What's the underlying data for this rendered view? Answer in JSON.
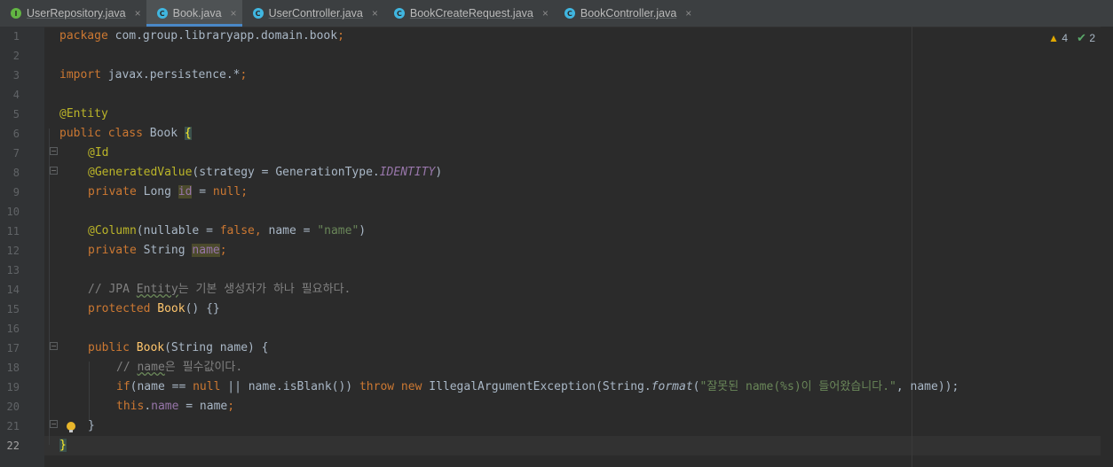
{
  "tabs": [
    {
      "label": "UserRepository.java",
      "icon": "interface-file-icon",
      "badge": "I",
      "active": false
    },
    {
      "label": "Book.java",
      "icon": "class-file-icon",
      "badge": "C",
      "active": true
    },
    {
      "label": "UserController.java",
      "icon": "class-file-icon",
      "badge": "C",
      "active": false
    },
    {
      "label": "BookCreateRequest.java",
      "icon": "class-file-icon",
      "badge": "C",
      "active": false
    },
    {
      "label": "BookController.java",
      "icon": "class-file-icon",
      "badge": "C",
      "active": false
    }
  ],
  "close_glyph": "×",
  "inspections": {
    "warnings": "4",
    "checks": "2",
    "warning_icon": "warning-triangle-icon",
    "check_icon": "double-check-icon"
  },
  "line_numbers": [
    "1",
    "2",
    "3",
    "4",
    "5",
    "6",
    "7",
    "8",
    "9",
    "10",
    "11",
    "12",
    "13",
    "14",
    "15",
    "16",
    "17",
    "18",
    "19",
    "20",
    "21",
    "22"
  ],
  "current_line": 22,
  "code": {
    "l1": {
      "kw": "package",
      "rest": " com.group.libraryapp.domain.book",
      "semi": ";"
    },
    "l3": {
      "kw": "import",
      "rest": " javax.persistence.*",
      "semi": ";"
    },
    "l5": {
      "an": "@Entity"
    },
    "l6": {
      "kw": "public class",
      "name": " Book ",
      "brace": "{"
    },
    "l7": {
      "an": "@Id"
    },
    "l8": {
      "an": "@GeneratedValue",
      "p1": "(strategy = GenerationType.",
      "const": "IDENTITY",
      "p2": ")"
    },
    "l9": {
      "kw": "private",
      "type": " Long ",
      "field": "id",
      "eq": " = ",
      "null": "null",
      "semi": ";"
    },
    "l11": {
      "an": "@Column",
      "p1": "(nullable = ",
      "fls": "false,",
      "p2": " name = ",
      "str": "\"name\"",
      "p3": ")"
    },
    "l12": {
      "kw": "private",
      "type": " String ",
      "field": "name",
      "semi": ";"
    },
    "l14": {
      "c1": "// JPA ",
      "c2": "Entity",
      "c3": "는 기본 생성자가 하나 필요하다."
    },
    "l15": {
      "kw": "protected",
      "name": " Book",
      "rest": "() {}"
    },
    "l17": {
      "kw": "public",
      "name": " Book",
      "rest": "(String name) {"
    },
    "l18": {
      "c1": "// ",
      "c2": "name",
      "c3": "은 필수값이다."
    },
    "l19": {
      "kw1": "if",
      "p1": "(name == ",
      "null": "null",
      "p2": " || name.isBlank()) ",
      "kw2": "throw new",
      "p3": " IllegalArgumentException(String.",
      "fmt": "format",
      "p4": "(",
      "str": "\"잘못된 name(%s)이 들어왔습니다.\"",
      "p5": ", name));"
    },
    "l20": {
      "kw": "this",
      "dot": ".",
      "field": "name",
      "rest": " = name",
      "semi": ";"
    },
    "l21": {
      "rest": "}"
    },
    "l22": {
      "brace": "}"
    }
  }
}
